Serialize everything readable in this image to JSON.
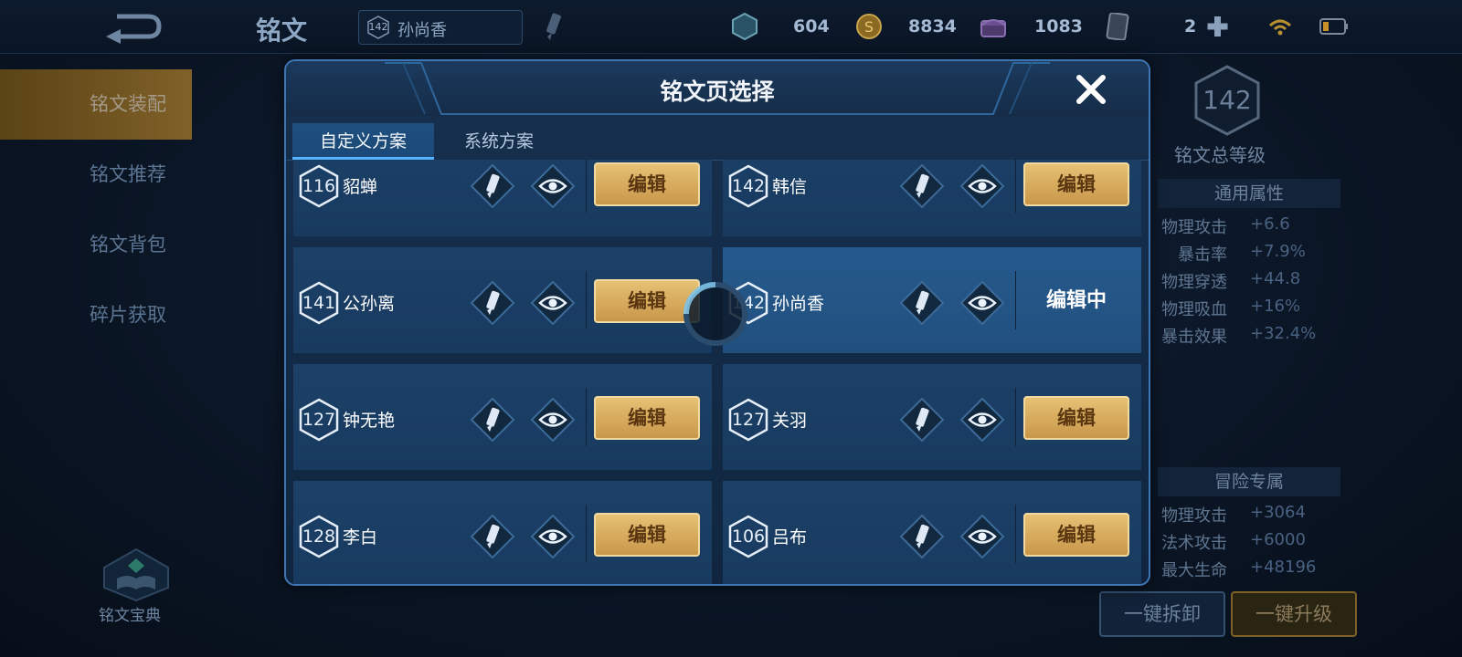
{
  "topbar": {
    "title": "铭文",
    "hero_level": "142",
    "hero_name": "孙尚香",
    "resources": [
      {
        "icon": "gem-icon",
        "value": "604"
      },
      {
        "icon": "gold-coin-icon",
        "value": "8834"
      },
      {
        "icon": "chest-icon",
        "value": "1083"
      },
      {
        "icon": "card-icon",
        "value": ""
      },
      {
        "icon": "plus-icon",
        "value": "2"
      }
    ]
  },
  "leftnav": {
    "items": [
      "铭文装配",
      "铭文推荐",
      "铭文背包",
      "碎片获取"
    ],
    "codex_label": "铭文宝典"
  },
  "rightpanel": {
    "total_level": "142",
    "total_label": "铭文总等级",
    "general_title": "通用属性",
    "general_stats": [
      {
        "k": "物理攻击",
        "v": "+6.6"
      },
      {
        "k": "暴击率",
        "v": "+7.9%"
      },
      {
        "k": "物理穿透",
        "v": "+44.8"
      },
      {
        "k": "物理吸血",
        "v": "+16%"
      },
      {
        "k": "暴击效果",
        "v": "+32.4%"
      }
    ],
    "adventure_title": "冒险专属",
    "adventure_stats": [
      {
        "k": "物理攻击",
        "v": "+3064"
      },
      {
        "k": "法术攻击",
        "v": "+6000"
      },
      {
        "k": "最大生命",
        "v": "+48196"
      }
    ],
    "unload_label": "一键拆卸",
    "upgrade_label": "一键升级"
  },
  "dialog": {
    "title": "铭文页选择",
    "tabs": [
      "自定义方案",
      "系统方案"
    ],
    "edit_label": "编辑",
    "editing_label": "编辑中",
    "pages": [
      {
        "level": "116",
        "name": "貂蝉"
      },
      {
        "level": "142",
        "name": "韩信"
      },
      {
        "level": "141",
        "name": "公孙离"
      },
      {
        "level": "142",
        "name": "孙尚香"
      },
      {
        "level": "127",
        "name": "钟无艳"
      },
      {
        "level": "127",
        "name": "关羽"
      },
      {
        "level": "128",
        "name": "李白"
      },
      {
        "level": "106",
        "name": "吕布"
      }
    ]
  },
  "colors": {
    "gold_button": "#d8ad5f",
    "active_tab_line": "#57b2ff",
    "dialog_border": "#3f75b3"
  }
}
